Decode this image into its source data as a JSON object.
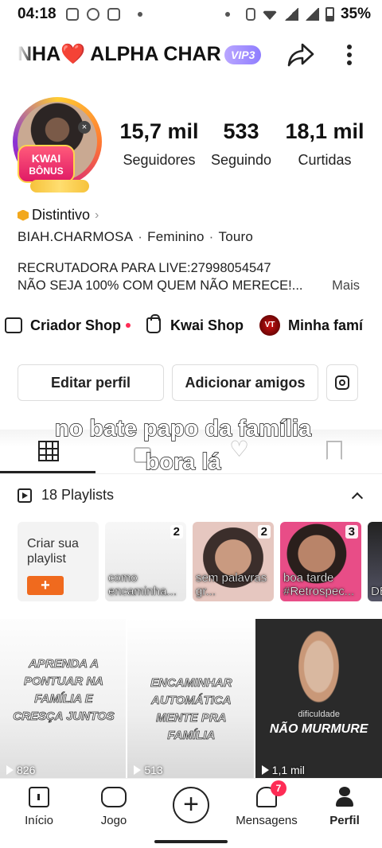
{
  "status_bar": {
    "time": "04:18",
    "battery": "35%"
  },
  "profile": {
    "display_name": "NHA❤️ ALPHA CHAR",
    "vip_badge": "VIP3",
    "avatar_badge": {
      "line1": "KWAI",
      "line2": "BÔNUS"
    },
    "stats": [
      {
        "value": "15,7 mil",
        "label": "Seguidores"
      },
      {
        "value": "533",
        "label": "Seguindo"
      },
      {
        "value": "18,1 mil",
        "label": "Curtidas"
      }
    ],
    "distintivo": "Distintivo",
    "username": "BIAH.CHARMOSA",
    "gender": "Feminino",
    "sign": "Touro",
    "bio_line1": "RECRUTADORA PARA LIVE:27998054547",
    "bio_line2": "NÃO SEJA 100% COM QUEM NÃO MERECE!...",
    "bio_more": "Mais"
  },
  "shops": {
    "item1": "Criador Shop",
    "item2": "Kwai Shop",
    "item3": "Minha famí"
  },
  "buttons": {
    "edit_profile": "Editar perfil",
    "add_friends": "Adicionar amigos"
  },
  "caption_overlay": {
    "line1": "no bate papo da família",
    "line2": "bora lá"
  },
  "playlists": {
    "header": "18 Playlists",
    "create_label": "Criar sua playlist",
    "create_button": "+",
    "items": [
      {
        "count": "2",
        "title": "como encaminha..."
      },
      {
        "count": "2",
        "title": "sem palavras gr..."
      },
      {
        "count": "3",
        "title": "boa tarde #Retrospec..."
      },
      {
        "count": "",
        "title": "DE AB"
      }
    ]
  },
  "videos": [
    {
      "overlay": "APRENDA A PONTUAR NA FAMÍLIA E CRESÇA JUNTOS",
      "views": "826"
    },
    {
      "overlay": "ENCAMINHAR AUTOMÁTICA MENTE PRA FAMÍLIA",
      "views": "513"
    },
    {
      "overlay_small": "dificuldade",
      "overlay": "NÃO MURMURE",
      "views": "1,1 mil"
    }
  ],
  "bottom_nav": {
    "home": "Início",
    "game": "Jogo",
    "create": "+",
    "messages": "Mensagens",
    "messages_badge": "7",
    "profile": "Perfil"
  },
  "colors": {
    "accent": "#fe2c55",
    "create_orange": "#f06a1e",
    "vip_purple": "#8f7dff"
  }
}
